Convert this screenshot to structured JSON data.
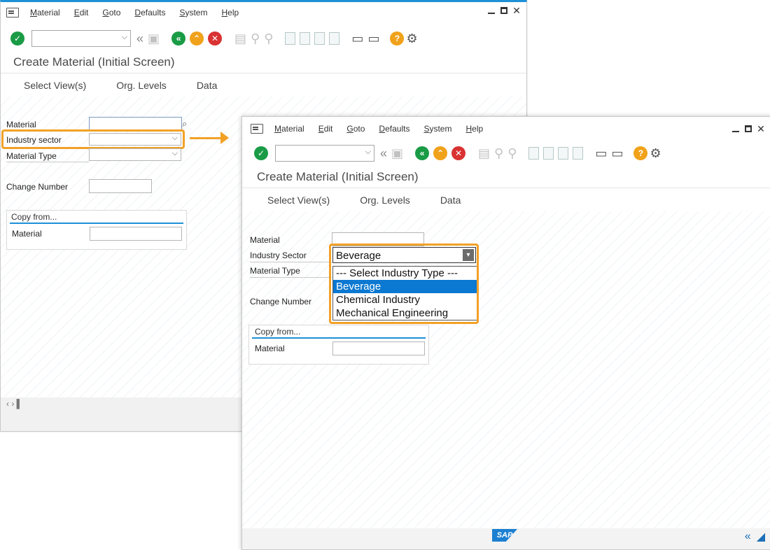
{
  "window1": {
    "menu": [
      "Material",
      "Edit",
      "Goto",
      "Defaults",
      "System",
      "Help"
    ],
    "title": "Create Material (Initial Screen)",
    "appbar": [
      "Select View(s)",
      "Org. Levels",
      "Data"
    ],
    "fields": {
      "material_label": "Material",
      "industry_sector_label": "Industry sector",
      "material_type_label": "Material Type",
      "change_number_label": "Change Number"
    },
    "copy_from": {
      "title": "Copy from...",
      "material_label": "Material"
    },
    "scroll_symbols": "‹ › ▌"
  },
  "window2": {
    "menu": [
      "Material",
      "Edit",
      "Goto",
      "Defaults",
      "System",
      "Help"
    ],
    "title": "Create Material (Initial Screen)",
    "appbar": [
      "Select View(s)",
      "Org. Levels",
      "Data"
    ],
    "fields": {
      "material_label": "Material",
      "industry_sector_label": "Industry Sector",
      "material_type_label": "Material Type",
      "change_number_label": "Change Number"
    },
    "dropdown": {
      "selected": "Beverage",
      "options": [
        "--- Select Industry Type ---",
        "Beverage",
        "Chemical Industry",
        "Mechanical Engineering"
      ]
    },
    "copy_from": {
      "title": "Copy from...",
      "material_label": "Material"
    },
    "logo_text": "SAP"
  },
  "colors": {
    "highlight": "#f2a127",
    "accent_blue": "#1e90d8",
    "selected_option": "#0b78d1"
  }
}
